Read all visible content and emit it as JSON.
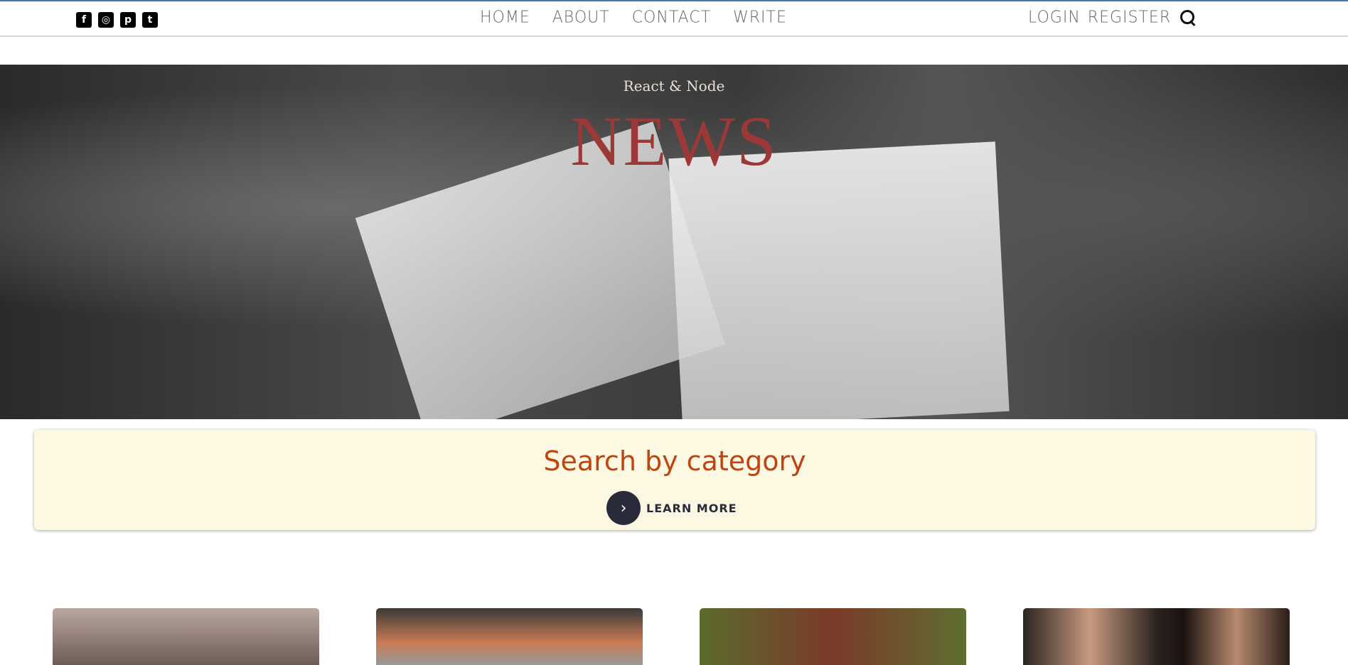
{
  "social": [
    "facebook-icon",
    "instagram-icon",
    "pinterest-icon",
    "twitter-icon"
  ],
  "nav": {
    "items": [
      "HOME",
      "ABOUT",
      "CONTACT",
      "WRITE"
    ]
  },
  "auth": {
    "login": "LOGIN",
    "register": "REGISTER",
    "search_icon": "search-icon"
  },
  "hero": {
    "subtitle": "React & Node",
    "title": "NEWS"
  },
  "category": {
    "title": "Search by category",
    "button": "LEARN MORE"
  },
  "colors": {
    "accent": "#c0440f",
    "title": "#9b3838",
    "box": "#fdf8e1",
    "button": "#2a2b3a"
  }
}
